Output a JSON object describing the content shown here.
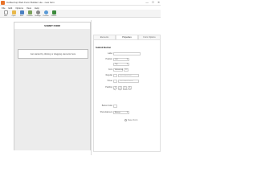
{
  "window": {
    "title": "CoffeeCup Web Form Builder Lite - new form",
    "controls": [
      "—",
      "☐",
      "✕"
    ]
  },
  "menu": [
    "File",
    "Edit",
    "Options",
    "View",
    "Help"
  ],
  "toolbar": [
    {
      "label": "New",
      "icon": "new-document-icon",
      "color": "#ffffff"
    },
    {
      "label": "Open",
      "icon": "open-folder-icon",
      "color": "#e8b84a"
    },
    {
      "label": "Save",
      "icon": "save-disk-icon",
      "color": "#4a7fc1"
    },
    {
      "label": "Preview",
      "icon": "preview-icon",
      "color": "#7aa05a"
    },
    {
      "label": "Settings",
      "icon": "settings-gear-icon",
      "color": "#8a8a8a"
    },
    {
      "label": "Preview",
      "icon": "browser-preview-icon",
      "color": "#5a9ad6"
    },
    {
      "label": "Publish",
      "icon": "publish-icon",
      "color": "#3c8a3c"
    }
  ],
  "form": {
    "title": "SUBMIT FORM",
    "drop_hint": "Get started by clicking or dragging elements here"
  },
  "tabs": [
    {
      "label": "Elements",
      "active": false
    },
    {
      "label": "Properties",
      "active": true
    },
    {
      "label": "Form Options",
      "active": false
    }
  ],
  "properties": {
    "header": "Submit Button",
    "label_label": "Label",
    "position_label": "Position",
    "position_value": "Left",
    "valign_value": "Top",
    "font_label": "Font",
    "font_value": "Helvetica",
    "font_size": "12",
    "regular_label": "Regular",
    "regular_placeholder": "text.submit.text",
    "hover_label": "Hover",
    "hover_placeholder": "text.submit.hover",
    "padding_label": "Padding",
    "padding_values": [
      "0",
      "0",
      "0",
      "0"
    ],
    "padding_sublabels": [
      "Top",
      "Right",
      "Bottom",
      "Left"
    ],
    "button_color_label": "Button Color",
    "show_element_label": "Show Element",
    "show_element_value": "Always",
    "reset_label": "Reset Form"
  }
}
